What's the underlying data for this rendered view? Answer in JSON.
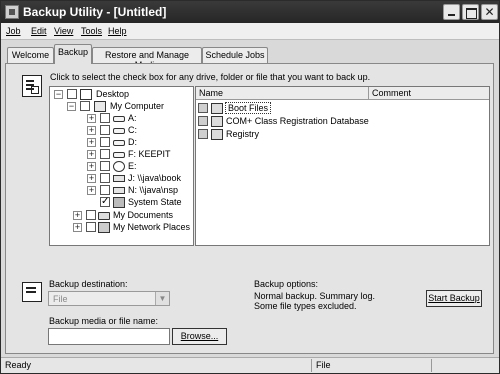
{
  "window": {
    "title": "Backup Utility - [Untitled]"
  },
  "menu": [
    "Job",
    "Edit",
    "View",
    "Tools",
    "Help"
  ],
  "tabs": [
    "Welcome",
    "Backup",
    "Restore and Manage Media",
    "Schedule Jobs"
  ],
  "active_tab": "Backup",
  "instructions": "Click to select the check box for any drive, folder or file that you want to back up.",
  "tree": [
    {
      "label": "Desktop",
      "icon": "desktop-icon",
      "expander": "−",
      "checked": false
    },
    {
      "label": "My Computer",
      "icon": "computer-icon",
      "expander": "−",
      "checked": false
    },
    {
      "label": "A:",
      "icon": "floppy-drive-icon",
      "expander": "+",
      "checked": false
    },
    {
      "label": "C:",
      "icon": "hard-drive-icon",
      "expander": "+",
      "checked": false
    },
    {
      "label": "D:",
      "icon": "hard-drive-icon",
      "expander": "+",
      "checked": false
    },
    {
      "label": "F: KEEPIT",
      "icon": "hard-drive-icon",
      "expander": "+",
      "checked": false
    },
    {
      "label": "E:",
      "icon": "cd-drive-icon",
      "expander": "+",
      "checked": false
    },
    {
      "label": "J: \\\\java\\book",
      "icon": "network-drive-icon",
      "expander": "+",
      "checked": false
    },
    {
      "label": "N: \\\\java\\nsp",
      "icon": "network-drive-icon",
      "expander": "+",
      "checked": false
    },
    {
      "label": "System State",
      "icon": "system-state-icon",
      "expander": "",
      "checked": true
    },
    {
      "label": "My Documents",
      "icon": "folder-icon",
      "expander": "+",
      "checked": false
    },
    {
      "label": "My Network Places",
      "icon": "network-places-icon",
      "expander": "+",
      "checked": false
    }
  ],
  "list": {
    "columns": [
      "Name",
      "Comment"
    ],
    "rows": [
      {
        "name": "Boot Files",
        "icon": "boot-files-icon",
        "comment": ""
      },
      {
        "name": "COM+ Class Registration Database",
        "icon": "com-database-icon",
        "comment": ""
      },
      {
        "name": "Registry",
        "icon": "registry-icon",
        "comment": ""
      }
    ]
  },
  "destination": {
    "label": "Backup destination:",
    "value": "File"
  },
  "media": {
    "label": "Backup media or file name:",
    "value": "",
    "browse_label": "Browse..."
  },
  "options": {
    "title": "Backup options:",
    "line1": "Normal backup.  Summary log.",
    "line2": "Some file types excluded."
  },
  "start_button": "Start Backup",
  "status": {
    "left": "Ready",
    "right": "File"
  }
}
